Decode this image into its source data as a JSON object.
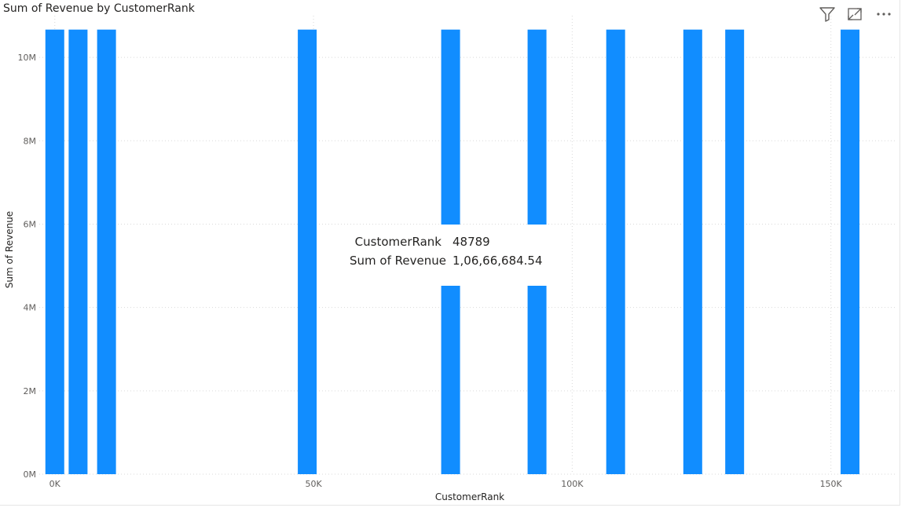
{
  "header": {
    "title": "Sum of Revenue by CustomerRank",
    "icons": [
      "filter-icon",
      "focus-mode-icon",
      "more-options-icon"
    ]
  },
  "chart_data": {
    "type": "bar",
    "title": "Sum of Revenue by CustomerRank",
    "xlabel": "CustomerRank",
    "ylabel": "Sum of Revenue",
    "xlim": [
      -3000,
      162500
    ],
    "ylim": [
      0,
      11000000
    ],
    "x_ticks": [
      0,
      50000,
      100000,
      150000
    ],
    "x_tick_labels": [
      "0K",
      "50K",
      "100K",
      "150K"
    ],
    "y_ticks": [
      0,
      2000000,
      4000000,
      6000000,
      8000000,
      10000000
    ],
    "y_tick_labels": [
      "0M",
      "2M",
      "4M",
      "6M",
      "8M",
      "10M"
    ],
    "grid": true,
    "bar_color": "#118DFF",
    "series": [
      {
        "x": [
          0,
          4500,
          10000,
          48789,
          76500,
          93200,
          108400,
          123300,
          131400,
          153700
        ],
        "values": [
          10666684.54,
          10666684.54,
          10666684.54,
          10666684.54,
          10666684.54,
          10666684.54,
          10666684.54,
          10666684.54,
          10666684.54,
          10666684.54
        ]
      }
    ]
  },
  "tooltip": {
    "rows": [
      {
        "label": "CustomerRank",
        "value": "48789"
      },
      {
        "label": "Sum of Revenue",
        "value": "1,06,66,684.54"
      }
    ]
  }
}
